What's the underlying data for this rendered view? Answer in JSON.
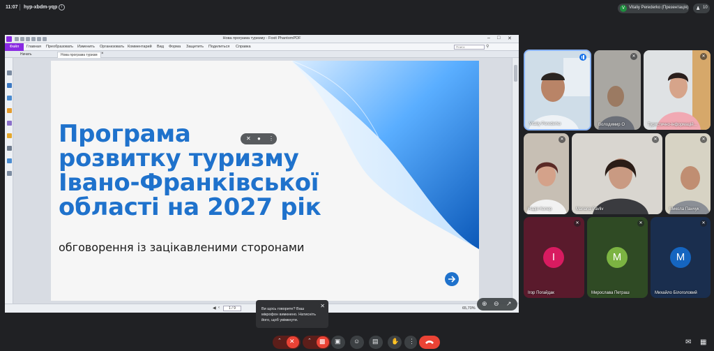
{
  "meeting": {
    "time": "11:07",
    "code": "hyp-xbdm-yqp"
  },
  "presenter": {
    "initial": "V",
    "label": "Vitaliy Perederko (Презентація)"
  },
  "people_count": "10",
  "app": {
    "window_title": "Нова програма туризму - Foxit PhantomPDF",
    "menu": {
      "file": "Файл",
      "items": [
        "Главная",
        "Преобразовать",
        "Изменить",
        "Организовать",
        "Комментарий",
        "Вид",
        "Форма",
        "Защитить",
        "Поделиться",
        "Справка"
      ]
    },
    "search_placeholder": "Поиск",
    "tabs": [
      "Начать",
      "Нова програма туризм"
    ],
    "page_indicator": "1 / 9",
    "zoom": "65,70%"
  },
  "slide": {
    "title_lines": [
      "Програма",
      "розвитку туризму",
      "Івано-Франківської",
      "області на 2027 рік"
    ],
    "subtitle": "обговорення із зацікавленими сторонами"
  },
  "participants": [
    {
      "name": "Vitaliy Perederko",
      "speaking": true
    },
    {
      "name": "Володимир О"
    },
    {
      "name": "Туристично-інформацій..."
    },
    {
      "name": "Надія Копер"
    },
    {
      "name": "Mariana Pavliv"
    },
    {
      "name": "Микола Панчук"
    },
    {
      "name": "Ігор Погайдак",
      "initial": "І",
      "color": "#d81b60"
    },
    {
      "name": "Мирослава Петраш",
      "initial": "М",
      "color": "#7cb342"
    },
    {
      "name": "Михайло Білоголовий",
      "initial": "М",
      "color": "#1565c0"
    }
  ],
  "toast": {
    "text": "Ви щось говорите? Ваш мікрофон вимкнено. Натисніть його, щоб увімкнути."
  },
  "colors": {
    "background": "#202124",
    "slide_title": "#1f72cc",
    "accent": "#1a73e8",
    "danger": "#ea4335"
  }
}
